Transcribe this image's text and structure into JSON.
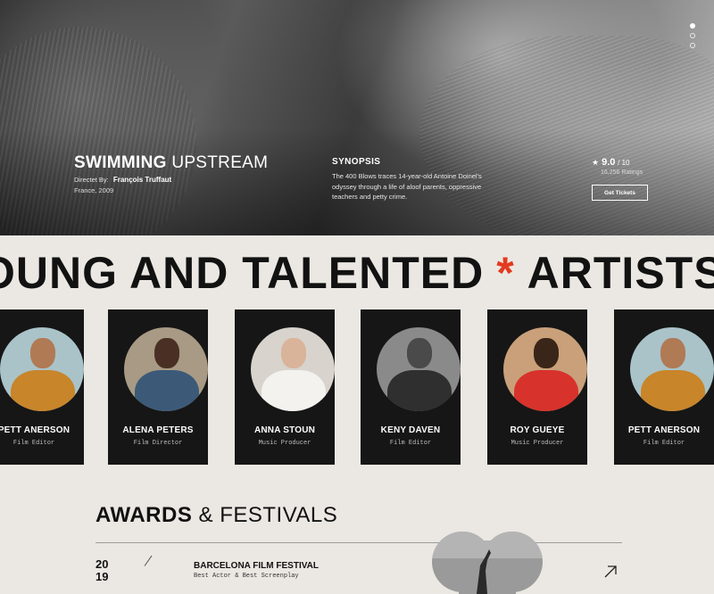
{
  "hero": {
    "title_bold": "SWIMMING",
    "title_light": "UPSTREAM",
    "director_label": "Directet By:",
    "director_name": "François Truffaut",
    "country_year": "France, 2009",
    "synopsis_heading": "SYNOPSIS",
    "synopsis_text": "The 400 Blows traces 14-year-old Antoine Doinel's odyssey through a life of aloof parents, oppressive teachers and petty crime.",
    "rating_star_icon": "star-icon",
    "rating_score": "9.0",
    "rating_outof": "/ 10",
    "rating_count": "16,256 Ratings",
    "tickets_button": "Get Tickets",
    "slider_dots": 3,
    "active_dot": 0
  },
  "marquee": {
    "part1": "OUNG AND TALENTED",
    "separator": "*",
    "part2": "ARTISTS W",
    "accent_color": "#e23b1f"
  },
  "artists": [
    {
      "name": "PETT ANERSON",
      "role": "Film Editor"
    },
    {
      "name": "ALENA PETERS",
      "role": "Film Director"
    },
    {
      "name": "ANNA STOUN",
      "role": "Music Producer"
    },
    {
      "name": "KENY DAVEN",
      "role": "Film Editor"
    },
    {
      "name": "ROY GUEYE",
      "role": "Music Producer"
    },
    {
      "name": "PETT ANERSON",
      "role": "Film Editor"
    }
  ],
  "awards": {
    "title_bold": "AWARDS",
    "title_light": "& FESTIVALS",
    "items": [
      {
        "year_top": "20",
        "year_bottom": "19",
        "festival": "BARCELONA FILM FESTIVAL",
        "detail": "Best Actor & Best Screenplay",
        "link_icon": "arrow-up-right-icon"
      }
    ]
  }
}
